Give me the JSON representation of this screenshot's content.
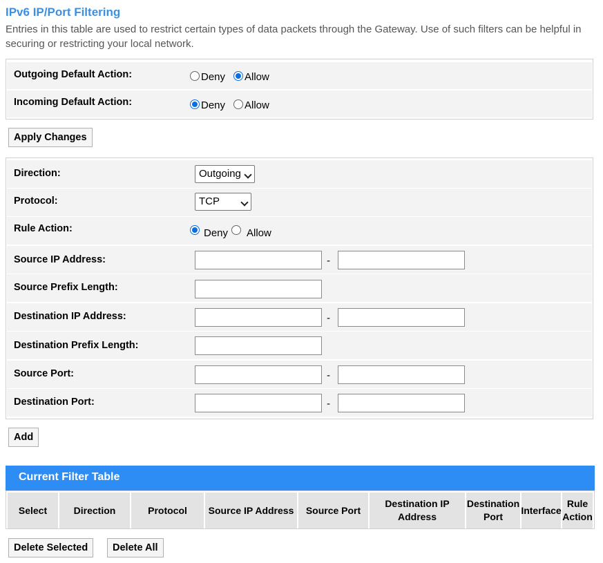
{
  "page": {
    "title": "IPv6 IP/Port Filtering",
    "description": "Entries in this table are used to restrict certain types of data packets through the Gateway. Use of such filters can be helpful in securing or restricting your local network."
  },
  "defaults": {
    "outgoing_label": "Outgoing Default Action:",
    "incoming_label": "Incoming Default Action:",
    "deny": "Deny",
    "allow": "Allow",
    "outgoing_selected": "Allow",
    "incoming_selected": "Deny",
    "apply_button": "Apply Changes"
  },
  "rule": {
    "direction_label": "Direction:",
    "direction_value": "Outgoing",
    "protocol_label": "Protocol:",
    "protocol_value": "TCP",
    "rule_action_label": "Rule Action:",
    "rule_action_deny": "Deny",
    "rule_action_allow": "Allow",
    "rule_action_selected": "Deny",
    "source_ip_label": "Source IP Address:",
    "source_prefix_label": "Source Prefix Length:",
    "dest_ip_label": "Destination IP Address:",
    "dest_prefix_label": "Destination Prefix Length:",
    "source_port_label": "Source Port:",
    "dest_port_label": "Destination Port:",
    "range_separator": "-",
    "source_ip_start": "",
    "source_ip_end": "",
    "source_prefix": "",
    "dest_ip_start": "",
    "dest_ip_end": "",
    "dest_prefix": "",
    "source_port_start": "",
    "source_port_end": "",
    "dest_port_start": "",
    "dest_port_end": "",
    "add_button": "Add"
  },
  "filter_table": {
    "title": "Current Filter Table",
    "columns": [
      "Select",
      "Direction",
      "Protocol",
      "Source IP Address",
      "Source Port",
      "Destination IP Address",
      "Destination Port",
      "Interface",
      "Rule Action"
    ],
    "rows": []
  },
  "actions": {
    "delete_selected": "Delete Selected",
    "delete_all": "Delete All"
  },
  "colors": {
    "accent": "#3d8fe0",
    "table_header": "#2e8df5",
    "radio_checked": "#0b6de0"
  }
}
